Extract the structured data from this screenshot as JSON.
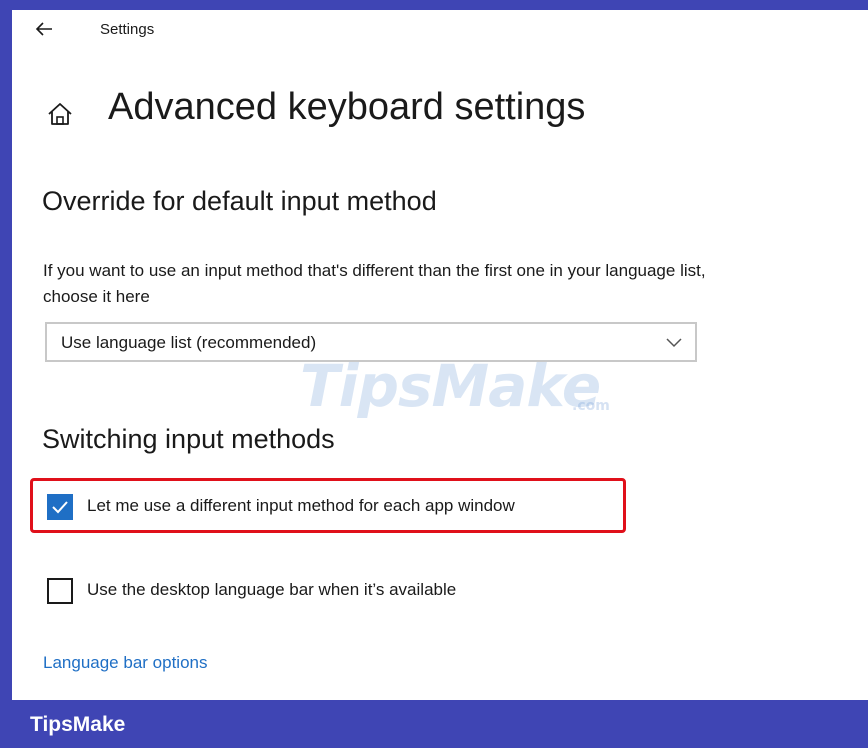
{
  "window": {
    "app_title": "Settings",
    "back_icon": "back-arrow-icon"
  },
  "page": {
    "home_icon": "home-icon",
    "title": "Advanced keyboard settings"
  },
  "override_section": {
    "title": "Override for default input method",
    "description": "If you want to use an input method that's different than the first one in your language list, choose it here",
    "dropdown": {
      "selected": "Use language list (recommended)",
      "icon": "chevron-down-icon"
    }
  },
  "switching_section": {
    "title": "Switching input methods",
    "options": [
      {
        "label": "Let me use a different input method for each app window",
        "checked": true
      },
      {
        "label": "Use the desktop language bar when it’s available",
        "checked": false
      }
    ],
    "link": "Language bar options"
  },
  "watermark": {
    "text": "TipsMake",
    "suffix": ".com"
  },
  "footer": {
    "brand": "TipsMake"
  },
  "colors": {
    "accent": "#1f6fc5",
    "highlight": "#e0101a",
    "brand_bar": "#3f45b4"
  }
}
